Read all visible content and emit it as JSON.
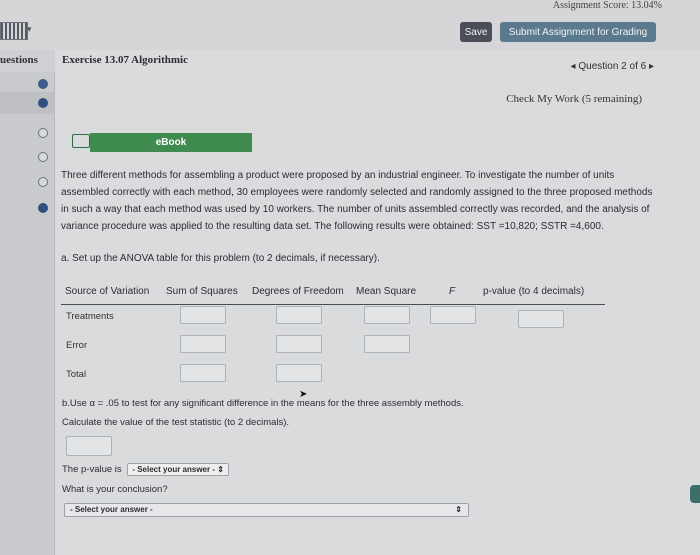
{
  "header": {
    "score": "Assignment Score: 13.04%",
    "save_label": "Save",
    "submit_label": "Submit Assignment for Grading"
  },
  "sidebar": {
    "title": "uestions"
  },
  "exercise": {
    "title": "Exercise 13.07 Algorithmic",
    "question_nav": "Question 2 of 6",
    "check_my_work": "Check My Work (5 remaining)",
    "ebook_label": "eBook"
  },
  "problem": {
    "text": "Three different methods for assembling a product were proposed by an industrial engineer. To investigate the number of units assembled correctly with each method, 30 employees were randomly selected and randomly assigned to the three proposed methods in such a way that each method was used by 10 workers. The number of units assembled correctly was recorded, and the analysis of variance procedure was applied to the resulting data set. The following results were obtained: SST =10,820; SSTR =4,600.",
    "part_a": "a. Set up the ANOVA table for this problem (to 2 decimals, if necessary).",
    "part_b": "b.Use α = .05 to test for any significant difference in the means for the three assembly methods.",
    "calc": "Calculate the value of the test statistic (to 2 decimals).",
    "pvalue_prefix": "The p-value is",
    "pvalue_select": "- Select your answer -",
    "conclusion_q": "What is your conclusion?",
    "conclusion_select": "- Select your answer -"
  },
  "table": {
    "headers": [
      "Source of Variation",
      "Sum of Squares",
      "Degrees of Freedom",
      "Mean Square",
      "F",
      "p-value (to 4 decimals)"
    ],
    "rows": [
      "Treatments",
      "Error",
      "Total"
    ]
  }
}
